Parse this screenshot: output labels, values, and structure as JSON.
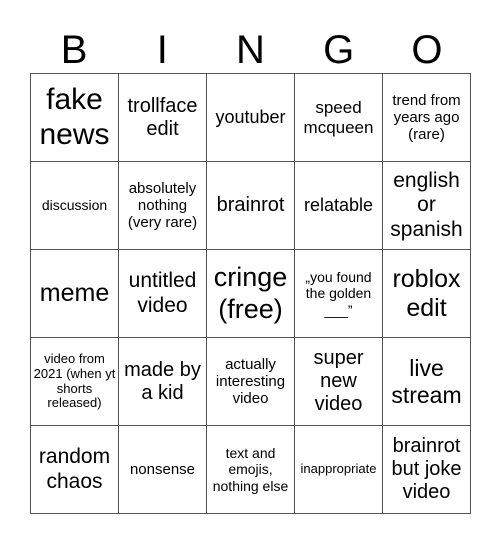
{
  "header": {
    "letters": [
      "B",
      "I",
      "N",
      "G",
      "O"
    ]
  },
  "cells": [
    "fake news",
    "trollface edit",
    "youtuber",
    "speed mcqueen",
    "trend from years ago (rare)",
    "discussion",
    "absolutely nothing (very rare)",
    "brainrot",
    "relatable",
    "english or spanish",
    "meme",
    "untitled video",
    "cringe (free)",
    "„you found the golden ___”",
    "roblox edit",
    "video from 2021 (when yt shorts released)",
    "made by a kid",
    "actually interesting video",
    "super new video",
    "live stream",
    "random chaos",
    "nonsense",
    "text and emojis, nothing else",
    "inappropriate",
    "brainrot but joke video"
  ]
}
